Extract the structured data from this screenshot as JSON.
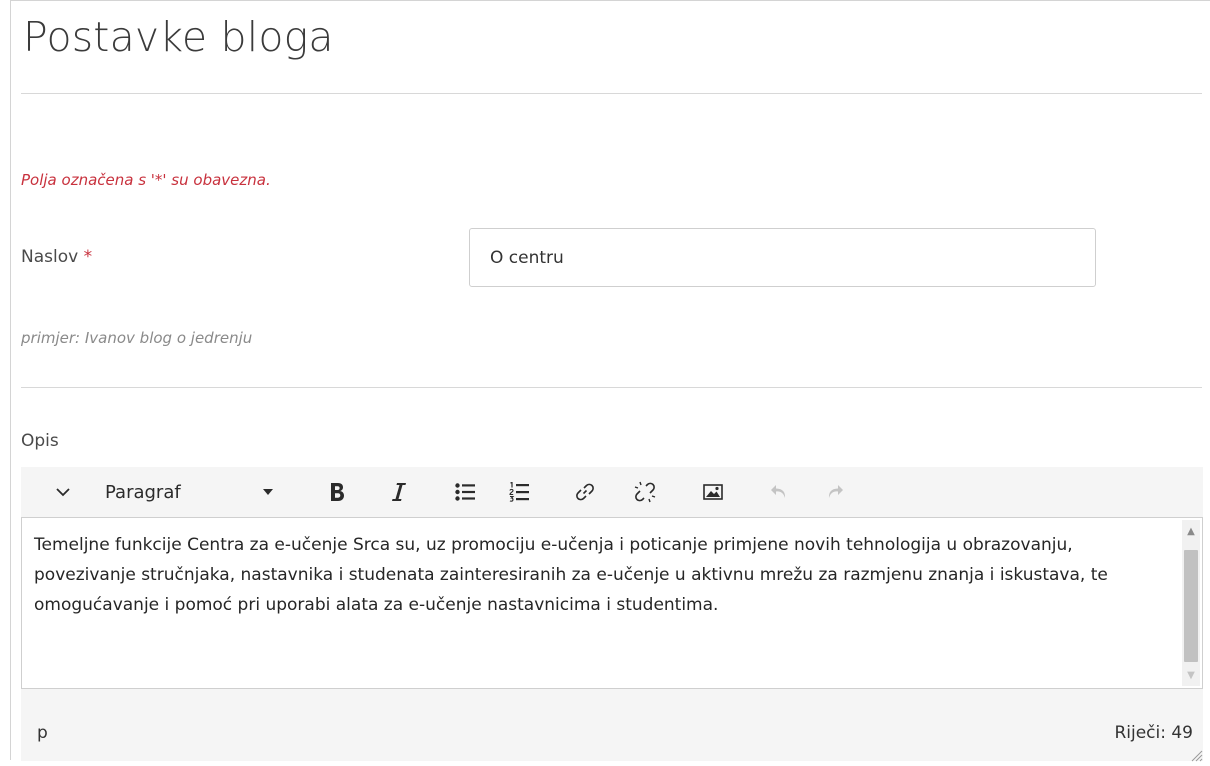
{
  "header": {
    "title": "Postavke bloga"
  },
  "form": {
    "required_note": "Polja označena s '*' su obavezna.",
    "title_field": {
      "label": "Naslov",
      "required_mark": "*",
      "value": "O centru",
      "hint": "primjer: Ivanov blog o jedrenju"
    },
    "description_field": {
      "label": "Opis"
    }
  },
  "editor": {
    "toolbar": {
      "format_select": "Paragraf",
      "icons": {
        "toggle": "chevron-down-icon",
        "format_dropdown": "caret-down-icon",
        "bold": "bold-icon",
        "italic": "italic-icon",
        "bullet_list": "bullet-list-icon",
        "numbered_list": "numbered-list-icon",
        "link": "link-icon",
        "unlink": "unlink-icon",
        "image": "image-icon",
        "undo": "undo-icon",
        "redo": "redo-icon"
      }
    },
    "content": "Temeljne funkcije Centra za e-učenje Srca su, uz promociju e-učenja i poticanje primjene novih tehnologija u obrazovanju, povezivanje stručnjaka, nastavnika i studenata zainteresiranih za e-učenje u aktivnu mrežu za razmjenu znanja i iskustava, te omogućavanje i pomoć pri uporabi alata za e-učenje nastavnicima i studentima.",
    "statusbar": {
      "path": "p",
      "word_count": "Riječi: 49"
    }
  },
  "colors": {
    "required": "#c8313d",
    "toolbar_bg": "#f5f5f5",
    "border": "#cfcfcf",
    "disabled_icon": "#c4c4c4"
  }
}
